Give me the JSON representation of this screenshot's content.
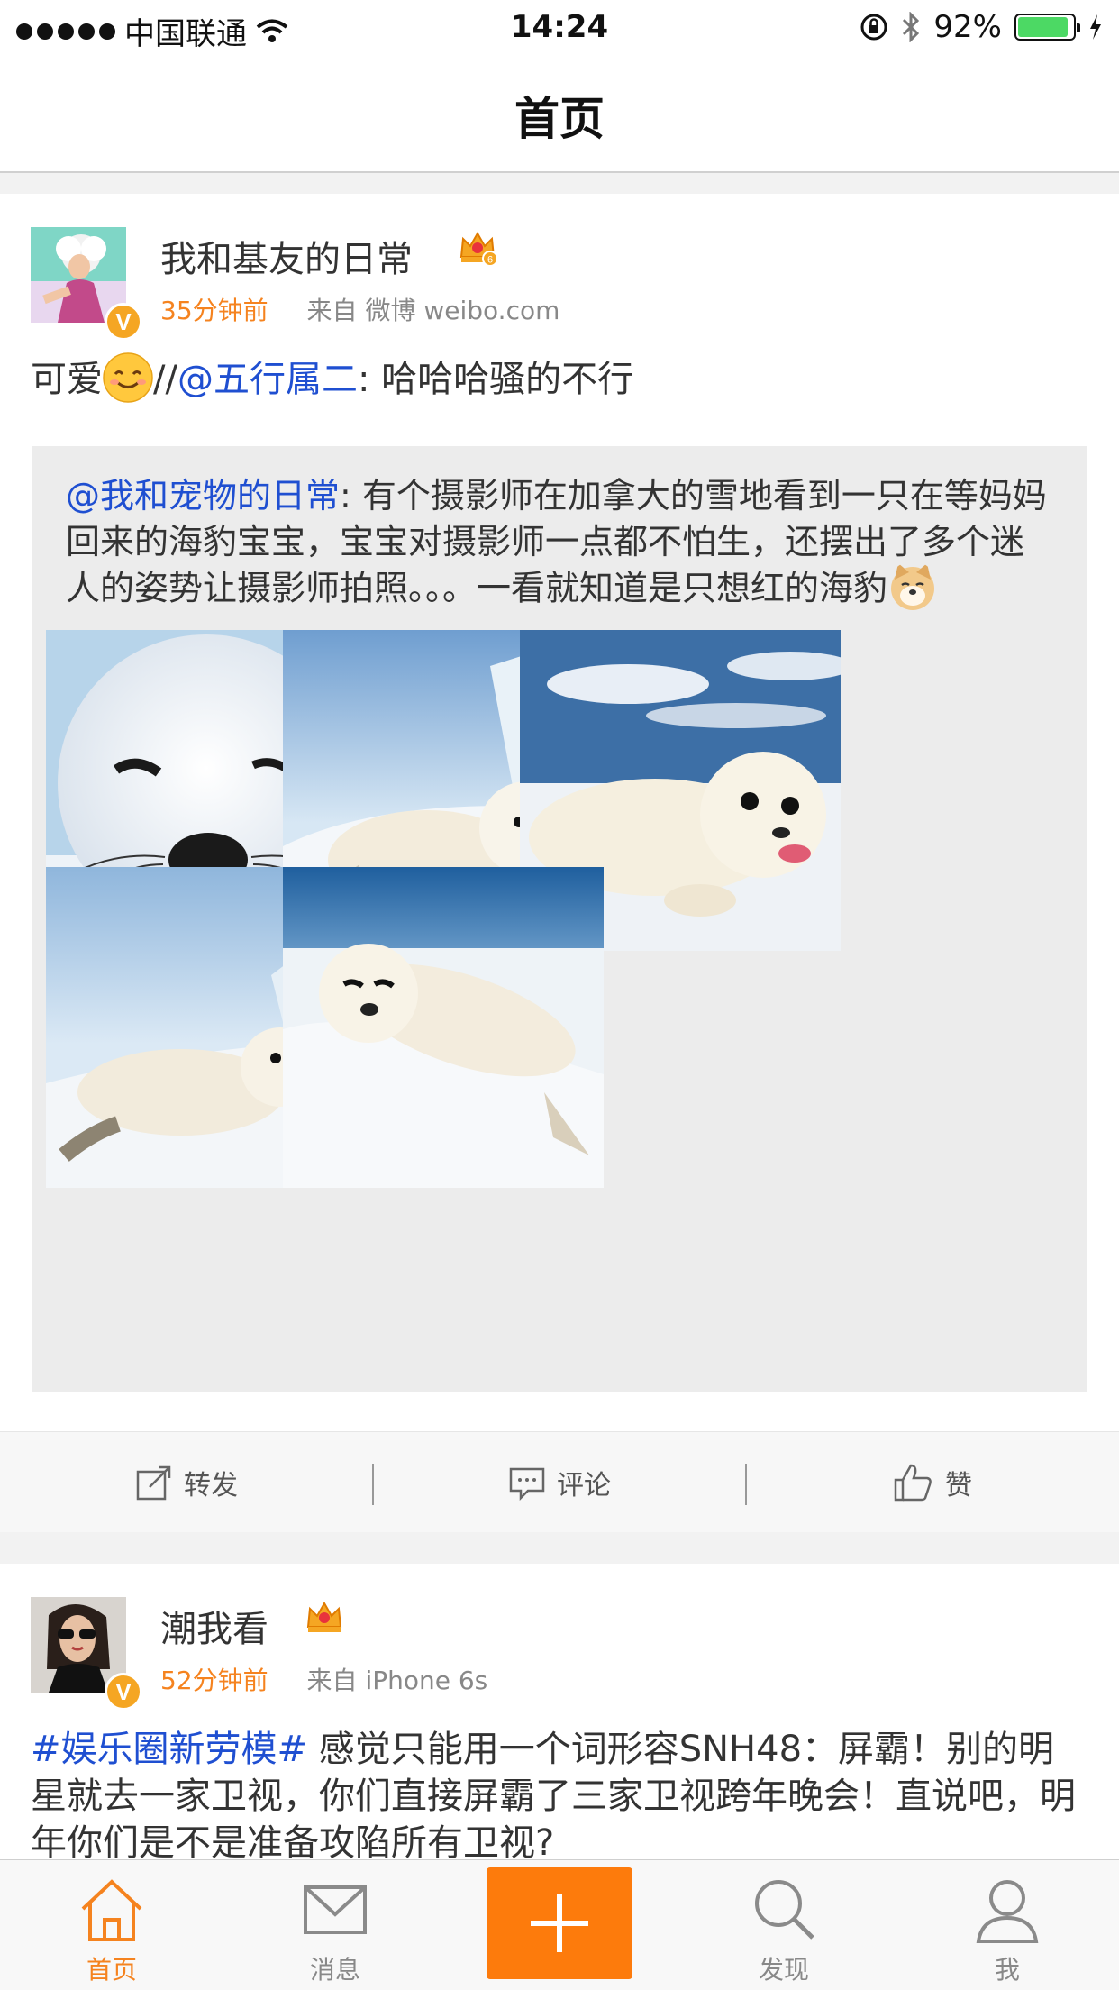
{
  "status_bar": {
    "carrier": "中国联通",
    "time": "14:24",
    "battery": "92%",
    "battery_level": 0.92
  },
  "nav": {
    "title": "首页"
  },
  "posts": [
    {
      "username": "我和基友的日常",
      "crown_level": "6",
      "time": "35分钟前",
      "source": "来自 微博 weibo.com",
      "text_before": "可爱",
      "text_sep": "//",
      "mention": "@五行属二",
      "text_after": ": 哈哈哈骚的不行",
      "repost": {
        "mention": "@我和宠物的日常",
        "text": ": 有个摄影师在加拿大的雪地看到一只在等妈妈回来的海豹宝宝，宝宝对摄影师一点都不怕生，还摆出了多个迷人的姿势让摄影师拍照。。。一看就知道是只想红的海豹"
      },
      "actions": {
        "repost": "转发",
        "comment": "评论",
        "like": "赞"
      }
    },
    {
      "username": "潮我看",
      "time": "52分钟前",
      "source": "来自 iPhone 6s",
      "hashtag": "#娱乐圈新劳模#",
      "text": " 感觉只能用一个词形容SNH48：屏霸！别的明星就去一家卫视，你们直接屏霸了三家卫视跨年晚会！直说吧，明年你们是不是准备攻陷所有卫视?"
    }
  ],
  "tabbar": {
    "home": "首页",
    "messages": "消息",
    "discover": "发现",
    "me": "我"
  },
  "colors": {
    "accent": "#f5831f",
    "link": "#1f4fd1",
    "compose": "#fd7b0c"
  }
}
